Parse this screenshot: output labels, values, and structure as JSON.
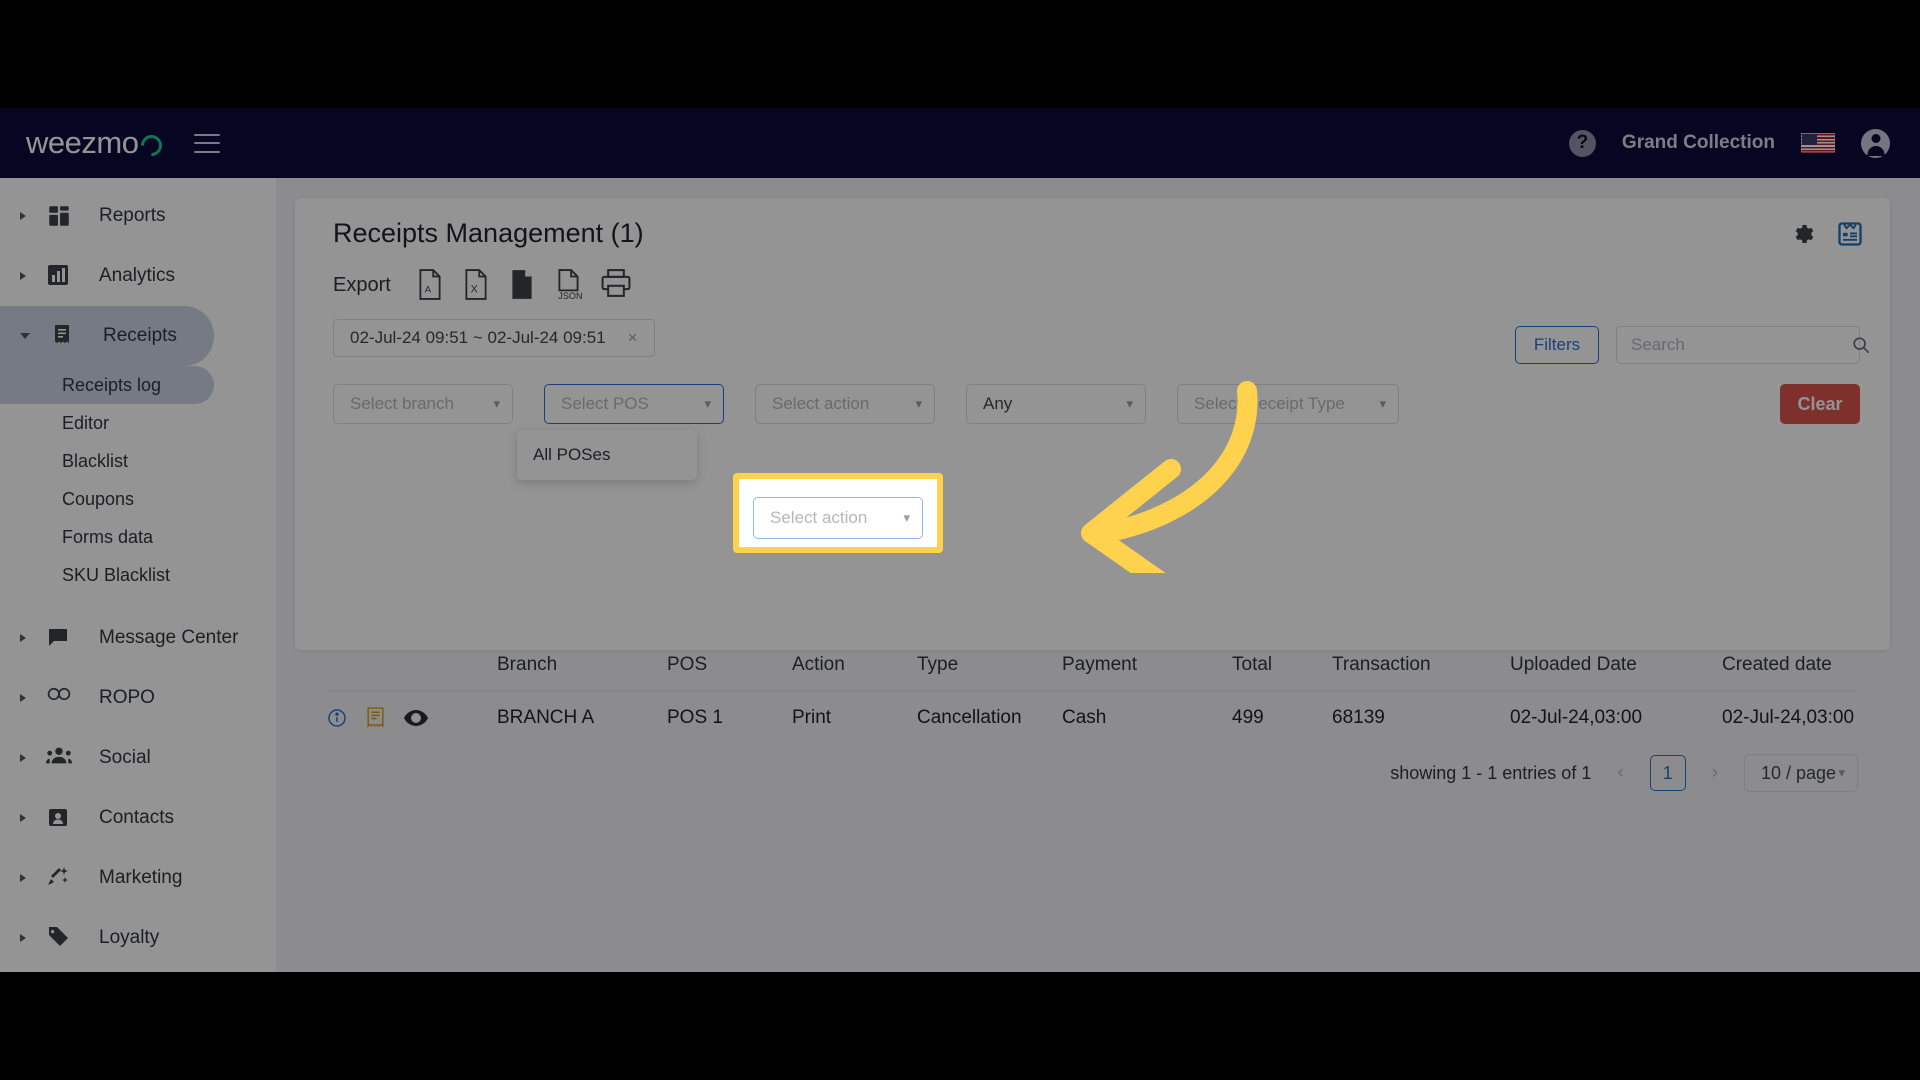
{
  "navbar": {
    "brand": "weezmo",
    "menu_icon": "hamburger-icon",
    "help_icon": "?",
    "company": "Grand Collection",
    "flag": "us-flag",
    "avatar_icon": "account-icon"
  },
  "sidebar": {
    "items": [
      {
        "label": "Reports",
        "icon": "dashboard-icon",
        "expanded": false
      },
      {
        "label": "Analytics",
        "icon": "bar-chart-icon",
        "expanded": false
      },
      {
        "label": "Receipts",
        "icon": "receipt-icon",
        "expanded": true
      },
      {
        "label": "Message Center",
        "icon": "chat-icon",
        "expanded": false
      },
      {
        "label": "ROPO",
        "icon": "infinity-icon",
        "expanded": false
      },
      {
        "label": "Social",
        "icon": "people-icon",
        "expanded": false
      },
      {
        "label": "Contacts",
        "icon": "contacts-icon",
        "expanded": false
      },
      {
        "label": "Marketing",
        "icon": "megaphone-icon",
        "expanded": false
      },
      {
        "label": "Loyalty",
        "icon": "tag-icon",
        "expanded": false
      }
    ],
    "receipts_subitems": [
      {
        "label": "Receipts log",
        "active": true
      },
      {
        "label": "Editor",
        "active": false
      },
      {
        "label": "Blacklist",
        "active": false
      },
      {
        "label": "Coupons",
        "active": false
      },
      {
        "label": "Forms data",
        "active": false
      },
      {
        "label": "SKU Blacklist",
        "active": false
      }
    ]
  },
  "card": {
    "title": "Receipts Management (1)",
    "gear_icon": "gear-icon",
    "report_icon": "receipt-report-icon",
    "export": {
      "label": "Export",
      "options": [
        {
          "name": "pdf-export",
          "label": "PDF"
        },
        {
          "name": "excel-export",
          "label": "X"
        },
        {
          "name": "doc-export",
          "label": "DOC"
        },
        {
          "name": "json-export",
          "label": "JSON"
        },
        {
          "name": "print-export",
          "label": "Print"
        }
      ]
    },
    "date_range": {
      "value": "02-Jul-24 09:51 ~ 02-Jul-24 09:51",
      "clear_icon": "×"
    },
    "filters": {
      "branch_placeholder": "Select branch",
      "pos_placeholder": "Select POS",
      "action_placeholder": "Select action",
      "type_value": "Any",
      "receipt_type_placeholder": "Select Receipt Type"
    },
    "pos_dropdown": {
      "options": [
        "All POSes"
      ]
    },
    "filters_button": "Filters",
    "search": {
      "placeholder": "Search",
      "value": "",
      "icon": "search-icon"
    },
    "clear_button": "Clear"
  },
  "table": {
    "columns": [
      "",
      "Branch",
      "POS",
      "Action",
      "Type",
      "Payment",
      "Total",
      "Transaction",
      "Uploaded Date",
      "Created date"
    ],
    "rows": [
      {
        "row_icons": [
          "info-icon",
          "receipt-icon",
          "eye-icon"
        ],
        "branch": "BRANCH A",
        "pos": "POS 1",
        "action": "Print",
        "type": "Cancellation",
        "payment": "Cash",
        "total": "499",
        "transaction": "68139",
        "uploaded_date": "02-Jul-24,03:00",
        "created_date": "02-Jul-24,03:00"
      }
    ]
  },
  "pagination": {
    "summary": "showing 1 - 1 entries of 1",
    "prev": "‹",
    "page": "1",
    "next": "›",
    "page_size": "10 / page"
  },
  "annotation": {
    "highlight_color": "#ffd24d",
    "arrow_color": "#ffd24d",
    "target": "Select action"
  },
  "colors": {
    "navbar_bg": "#0b0b3b",
    "accent_blue": "#2f6fd0",
    "clear_red": "#d9534f",
    "brand_green": "#20c997",
    "highlight_yellow": "#ffd24d"
  }
}
